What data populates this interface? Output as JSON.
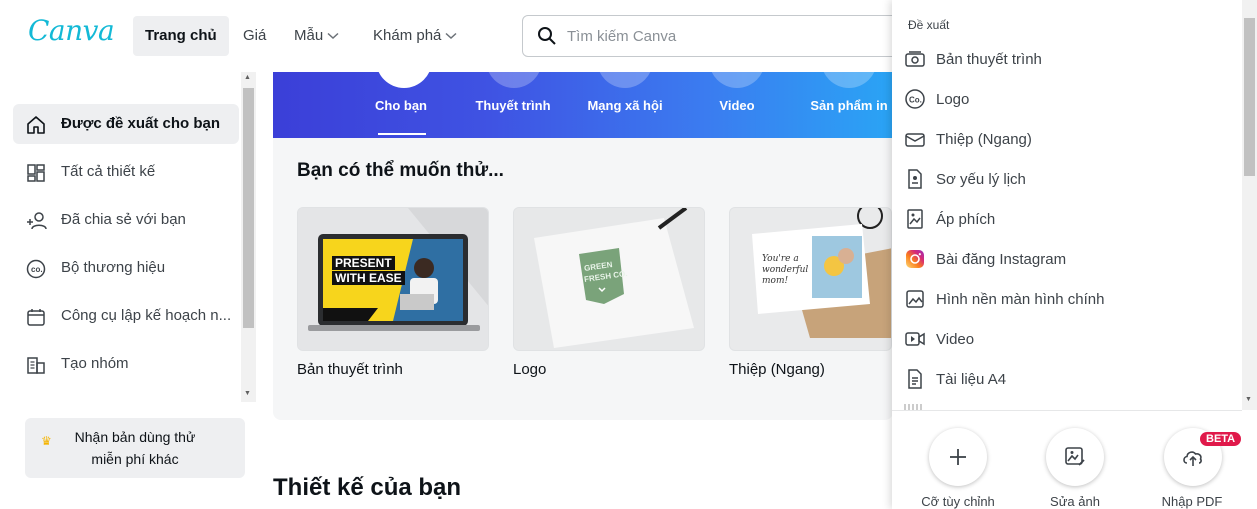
{
  "brand": {
    "logo_text": "Canva",
    "logo_color": "#13b9d6"
  },
  "nav": {
    "items": [
      {
        "label": "Trang chủ",
        "active": true,
        "has_chevron": false
      },
      {
        "label": "Giá",
        "active": false,
        "has_chevron": false
      },
      {
        "label": "Mẫu",
        "active": false,
        "has_chevron": true
      },
      {
        "label": "Khám phá",
        "active": false,
        "has_chevron": true
      }
    ]
  },
  "search": {
    "placeholder": "Tìm kiếm Canva",
    "value": ""
  },
  "sidebar": {
    "items": [
      {
        "label": "Được đề xuất cho bạn",
        "icon": "home-icon",
        "active": true
      },
      {
        "label": "Tất cả thiết kế",
        "icon": "grid-icon",
        "active": false
      },
      {
        "label": "Đã chia sẻ với bạn",
        "icon": "shared-users-icon",
        "active": false
      },
      {
        "label": "Bộ thương hiệu",
        "icon": "brand-kit-icon",
        "active": false
      },
      {
        "label": "Công cụ lập kế hoạch n...",
        "icon": "calendar-icon",
        "active": false
      },
      {
        "label": "Tạo nhóm",
        "icon": "team-icon",
        "active": false
      }
    ],
    "trial_button": {
      "line1": "Nhận bản dùng thử",
      "line2": "miễn phí khác",
      "icon": "crown-icon"
    }
  },
  "hero": {
    "tabs": [
      {
        "label": "Cho bạn",
        "selected": true
      },
      {
        "label": "Thuyết trình",
        "selected": false
      },
      {
        "label": "Mạng xã hội",
        "selected": false
      },
      {
        "label": "Video",
        "selected": false
      },
      {
        "label": "Sản phẩm in",
        "selected": false
      }
    ]
  },
  "suggestions": {
    "title": "Bạn có thể muốn thử...",
    "cards": [
      {
        "label": "Bản thuyết trình",
        "thumb_line1": "PRESENT",
        "thumb_line2": "WITH EASE"
      },
      {
        "label": "Logo",
        "thumb_line1": "GREEN",
        "thumb_line2": "FRESH CO."
      },
      {
        "label": "Thiệp (Ngang)",
        "thumb_line1": "You're a",
        "thumb_line2": "wonderful",
        "thumb_line3": "mom!"
      }
    ]
  },
  "your_designs": {
    "title": "Thiết kế của bạn"
  },
  "dropdown": {
    "heading": "Đề xuất",
    "items": [
      {
        "label": "Bản thuyết trình",
        "icon": "presentation-icon"
      },
      {
        "label": "Logo",
        "icon": "logo-icon"
      },
      {
        "label": "Thiệp (Ngang)",
        "icon": "card-icon"
      },
      {
        "label": "Sơ yếu lý lịch",
        "icon": "resume-icon"
      },
      {
        "label": "Áp phích",
        "icon": "poster-icon"
      },
      {
        "label": "Bài đăng Instagram",
        "icon": "instagram-icon"
      },
      {
        "label": "Hình nền màn hình chính",
        "icon": "wallpaper-icon"
      },
      {
        "label": "Video",
        "icon": "video-icon"
      },
      {
        "label": "Tài liệu A4",
        "icon": "document-icon"
      }
    ],
    "actions": [
      {
        "label": "Cỡ tùy chỉnh",
        "icon": "plus-icon"
      },
      {
        "label": "Sửa ảnh",
        "icon": "edit-photo-icon"
      },
      {
        "label": "Nhập PDF",
        "icon": "upload-cloud-icon",
        "badge": "BETA"
      }
    ]
  },
  "colors": {
    "accent": "#13b9d6",
    "hero_start": "#3b3fd8",
    "hero_end": "#2aa4f5",
    "beta": "#e0194a"
  }
}
